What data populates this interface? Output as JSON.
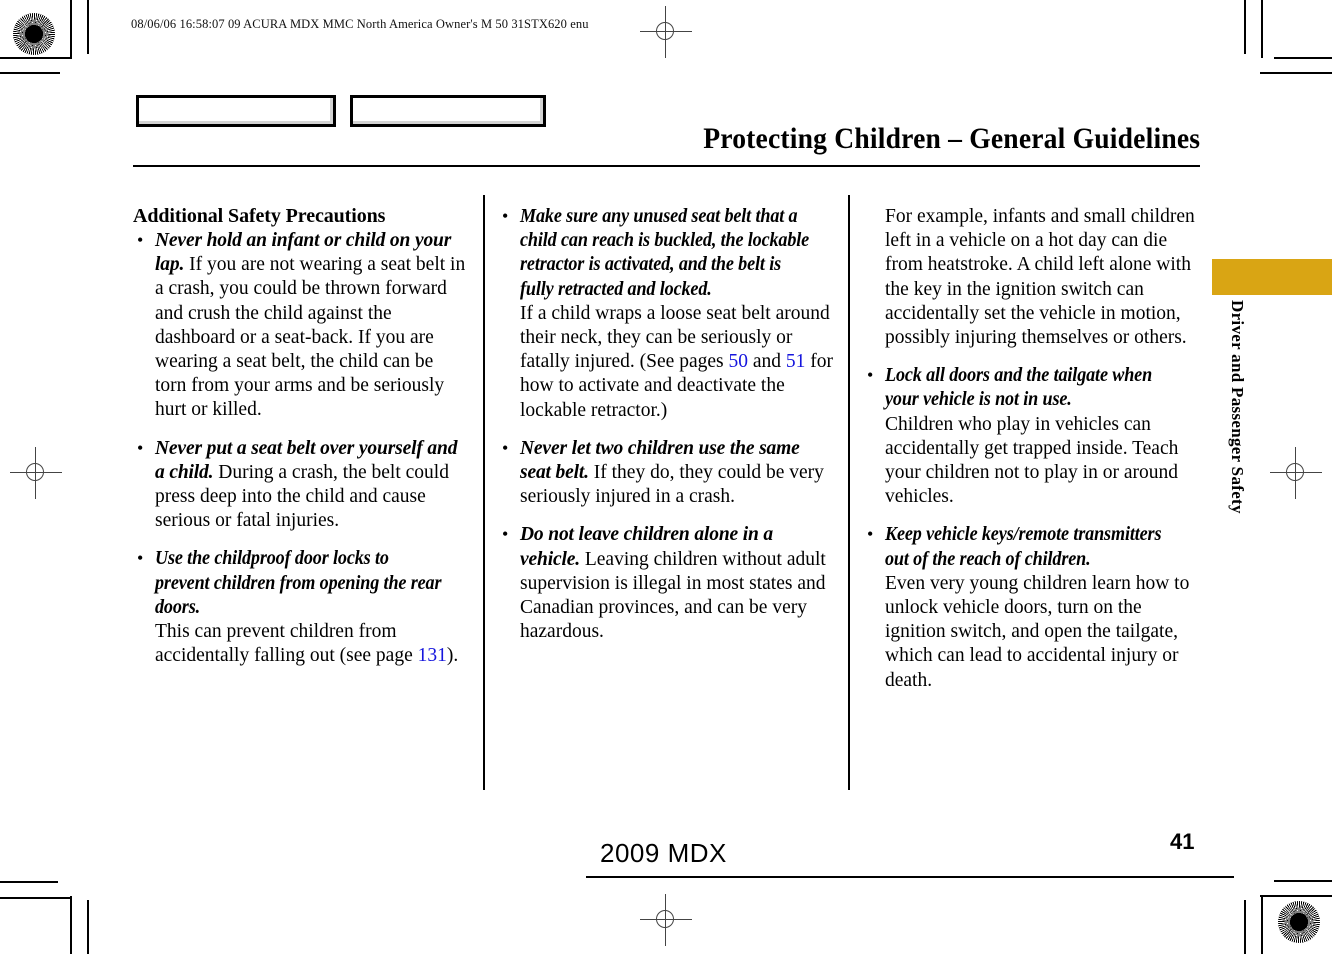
{
  "print_meta": {
    "header_line": "08/06/06 16:58:07   09 ACURA MDX MMC North America Owner's M 50 31STX620 enu"
  },
  "header": {
    "chip_1_label": "",
    "chip_2_label": "",
    "title": "Protecting Children – General Guidelines"
  },
  "side_tab": {
    "label": "Driver and Passenger Safety",
    "color": "#d9a514"
  },
  "footer": {
    "model": "2009  MDX",
    "page_number": "41"
  },
  "columns": {
    "col1": {
      "section_heading": "Additional Safety Precautions",
      "bullets": [
        {
          "lead": "Never hold an infant or child on your lap.",
          "body": " If you are not wearing a seat belt in a crash, you could be thrown forward and crush the child against the dashboard or a seat-back. If you are wearing a seat belt, the child can be torn from your arms and be seriously hurt or killed."
        },
        {
          "lead": "Never put a seat belt over yourself and a child.",
          "body": " During a crash, the belt could press deep into the child and cause serious or fatal injuries."
        },
        {
          "lead": "Use the childproof door locks to prevent children from opening the rear doors.",
          "body": " This can prevent children from accidentally falling out (see page ",
          "page_ref": "131",
          "body_tail": ")."
        }
      ]
    },
    "col2": {
      "bullets": [
        {
          "lead": "Make sure any unused seat belt that a child can reach is buckled, the lockable retractor is activated, and the belt is fully retracted and locked.",
          "body": " If a child wraps a loose seat belt around their neck, they can be seriously or fatally injured. (See pages ",
          "page_ref": "50",
          "body_mid": " and ",
          "page_ref_2": "51",
          "body_tail": " for how to activate and deactivate the lockable retractor.)"
        },
        {
          "lead": "Never let two children use the same seat belt.",
          "body": " If they do, they could be very seriously injured in a crash."
        },
        {
          "lead": "Do not leave children alone in a vehicle.",
          "body": " Leaving children without adult supervision is illegal in most states and Canadian provinces, and can be very hazardous."
        }
      ]
    },
    "col3": {
      "intro_paragraph": "For example, infants and small children left in a vehicle on a hot day can die from heatstroke. A child left alone with the key in the ignition switch can accidentally set the vehicle in motion, possibly injuring themselves or others.",
      "bullets": [
        {
          "lead": "Lock all doors and the tailgate when your vehicle is not in use.",
          "body": " Children who play in vehicles can accidentally get trapped inside. Teach your children not to play in or around vehicles."
        },
        {
          "lead": "Keep vehicle keys/remote transmitters out of the reach of children.",
          "body": " Even very young children learn how to unlock vehicle doors, turn on the ignition switch, and open the tailgate, which can lead to accidental injury or death."
        }
      ]
    }
  }
}
